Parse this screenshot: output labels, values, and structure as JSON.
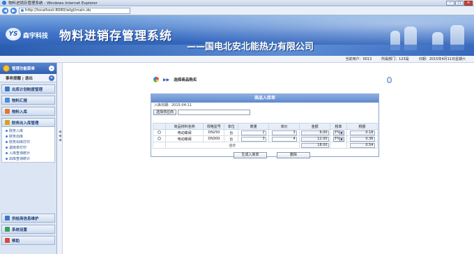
{
  "window": {
    "title": "物料进销存管理系统 - Windows Internet Explorer",
    "controls": {
      "minimize": "–",
      "maximize": "□",
      "close": "✕"
    }
  },
  "browser": {
    "back": "◀",
    "forward": "▶",
    "url": "http://localhost:8080/wlgl/main.do"
  },
  "banner": {
    "logo_mark": "YS",
    "company_short": "森宇科技",
    "system_title": "物料进销存管理系统",
    "company_full": "——国电北安北能热力有限公司"
  },
  "infobar": {
    "user": "当前用户：0013",
    "dept": "所属部门：123是",
    "date": "日期：2015年4月11日星期六"
  },
  "sidebar": {
    "header": "管理功能菜单",
    "collapse": "«",
    "top_links": "事务提醒 | 退出",
    "groups": [
      {
        "label": "出库计划制度管理",
        "color": "#3b78c9",
        "items": []
      },
      {
        "label": "物料汇报",
        "color": "#4a8ad8",
        "items": []
      },
      {
        "label": "物料入库",
        "color": "#e07a2b",
        "items": []
      },
      {
        "label": "财务出入库管理",
        "color": "#d9a21c",
        "items": [
          "财务入库",
          "财务出库",
          "财务出库打印",
          "退库单打印",
          "入库查询统计",
          "出库查询统计"
        ]
      },
      {
        "label": "供给商信息维护",
        "color": "#3b78c9",
        "items": []
      },
      {
        "label": "系统设置",
        "color": "#3b9e5b",
        "items": []
      },
      {
        "label": "帮助",
        "color": "#d44b3b",
        "items": []
      }
    ]
  },
  "main": {
    "breadcrumb": "选择商品购买",
    "play_icon": "▶▶",
    "panel_title": "商品入库单",
    "entry_date": "入库日期：2015-04-11",
    "choose_supplier": "选择供应商",
    "supplier_value": "",
    "columns": [
      "",
      "商品材料名称",
      "规格型号",
      "单位",
      "数量",
      "单价",
      "金额",
      "税率",
      "税额"
    ],
    "rows": [
      {
        "name": "电动蝶阀",
        "spec": "DN250",
        "unit": "台",
        "qty": "2",
        "price": "3",
        "amount": "6.00",
        "rate": "3%",
        "tax": "0.18"
      },
      {
        "name": "电动蝶阀",
        "spec": "DN300",
        "unit": "台",
        "qty": "3",
        "price": "4",
        "amount": "12.00",
        "rate": "3%",
        "tax": "0.36"
      }
    ],
    "total_label": "合计",
    "total_amount": "18.00",
    "total_tax": "0.54",
    "generate_btn": "生成入库单",
    "delete_btn": "删除"
  }
}
